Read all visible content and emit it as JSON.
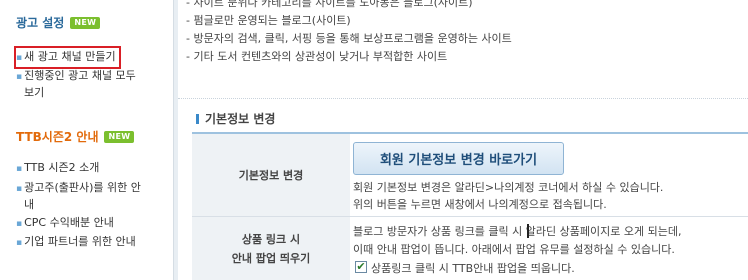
{
  "sidebar": {
    "ad_section": {
      "title": "광고 설정",
      "badge": "NEW",
      "items": [
        {
          "label": "새 광고 채널 만들기",
          "active": true
        },
        {
          "label": "진행중인 광고 채널 모두",
          "label2": "보기"
        }
      ]
    },
    "ttb_section": {
      "title": "TTB시즌2 안내",
      "badge": "NEW",
      "items": [
        {
          "label": "TTB 시즌2 소개"
        },
        {
          "label": "광고주(출판사)를 위한 안",
          "label2": "내"
        },
        {
          "label": "CPC 수익배분 안내"
        },
        {
          "label": "기업 파트너를 위한 안내"
        }
      ]
    }
  },
  "main": {
    "intro_lines": [
      "- 사이트 분위나 카테고리를 사이트를 도아동은 블로그(사이트)",
      "- 펌글로만 운영되는 블로그(사이트)",
      "- 방문자의 검색, 클릭, 서핑 등을 통해 보상프로그램을 운영하는 사이트",
      "- 기타 도서 컨텐츠와의 상관성이 낮거나 부적합한 사이트"
    ],
    "section_title": "기본정보 변경",
    "rows": [
      {
        "label": "기본정보 변경",
        "button": "회원 기본정보 변경 바로가기",
        "lines": [
          "회원 기본정보 변경은 알라딘>나의계정 코너에서 하실 수 있습니다.",
          "위의 버튼을 누르면 새창에서 나의계정으로 접속됩니다."
        ]
      },
      {
        "label": "상품 링크 시",
        "label2": "안내 팝업 띄우기",
        "lines": [
          "블로그 방문자가 상품 링크를 클릭 시 알라딘 상품페이지로 오게 되는데,",
          "이때 안내 팝업이 뜹니다. 아래에서 팝업 유무를 설정하실 수 있습니다."
        ],
        "checkbox_label": "상품링크 클릭 시 TTB안내 팝업을 띄웁니다.",
        "checkbox_checked": true
      }
    ]
  },
  "colors": {
    "ad_title": "#2b6a9b",
    "ttb_title": "#e26a0b",
    "badge": "#7bbf2e",
    "active_border": "#d91f26",
    "row_label_bg": "#eef2f5",
    "button_text": "#1f4e7a"
  }
}
